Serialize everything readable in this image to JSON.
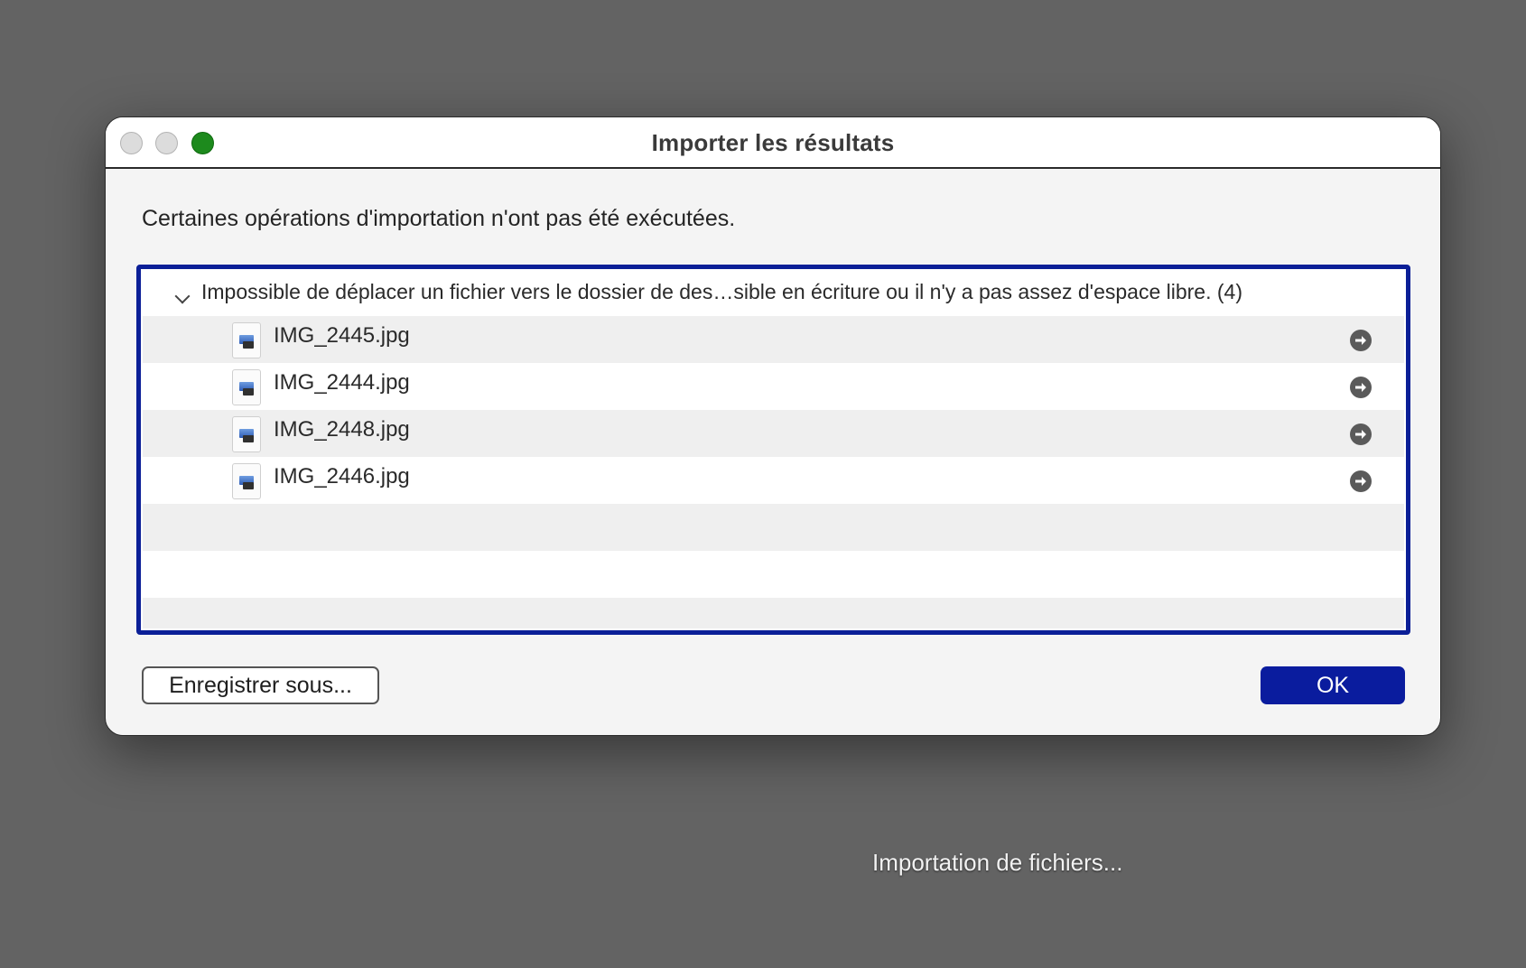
{
  "window": {
    "title": "Importer les résultats",
    "buttons": [
      "close",
      "minimize",
      "zoom"
    ]
  },
  "message": "Certaines opérations d'importation n'ont pas été exécutées.",
  "results": {
    "group_label": "Impossible de déplacer un fichier vers le dossier de des…sible en écriture ou il n'y a pas assez d'espace libre. (4)",
    "expanded": true,
    "files": [
      {
        "name": "IMG_2445.jpg",
        "icon": "jpg-file-icon",
        "action_icon": "reveal-arrow-icon"
      },
      {
        "name": "IMG_2444.jpg",
        "icon": "jpg-file-icon",
        "action_icon": "reveal-arrow-icon"
      },
      {
        "name": "IMG_2448.jpg",
        "icon": "jpg-file-icon",
        "action_icon": "reveal-arrow-icon"
      },
      {
        "name": "IMG_2446.jpg",
        "icon": "jpg-file-icon",
        "action_icon": "reveal-arrow-icon"
      }
    ]
  },
  "buttons": {
    "save_as": "Enregistrer sous...",
    "ok": "OK"
  },
  "status_text": "Importation de fichiers...",
  "colors": {
    "background": "#636363",
    "accent": "#0a1c9e",
    "zoom_button": "#1d8a1d"
  }
}
